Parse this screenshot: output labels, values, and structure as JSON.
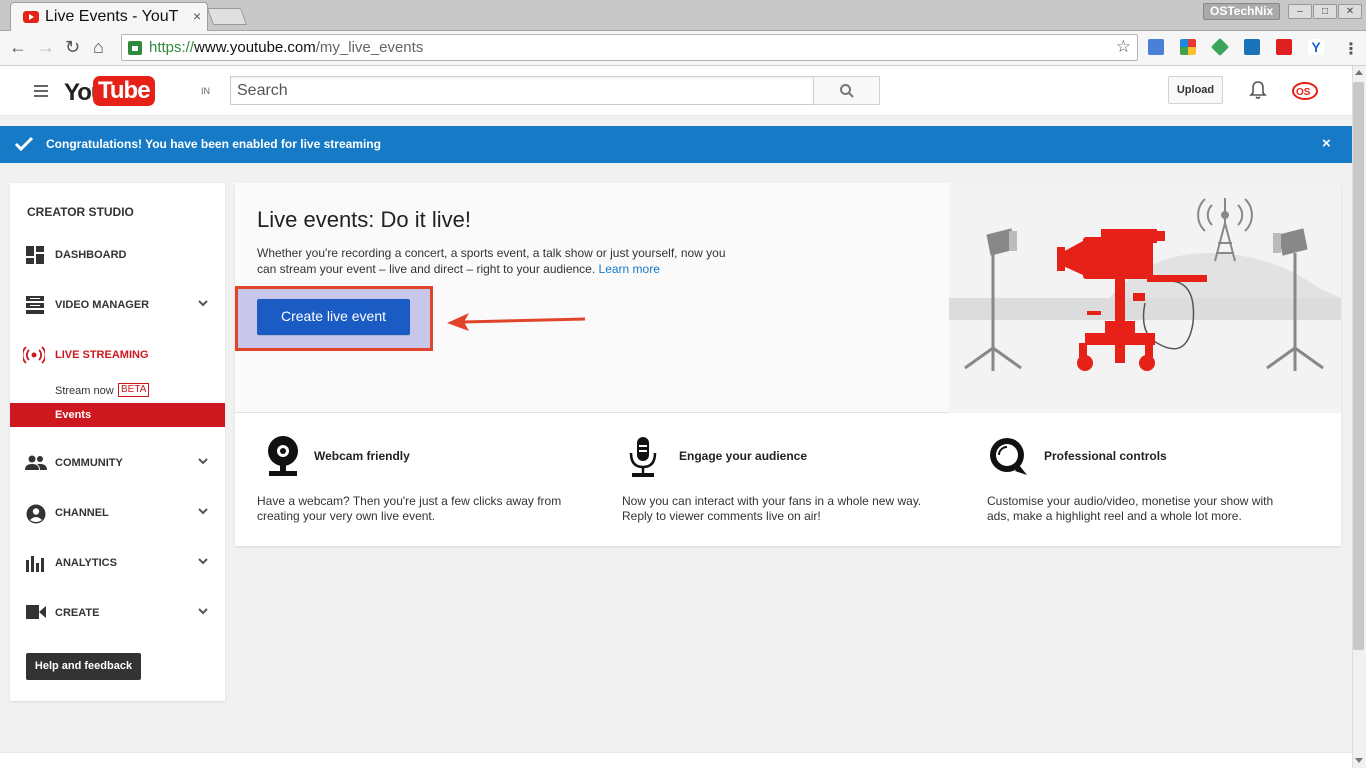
{
  "browser": {
    "tab_title": "Live Events - YouT",
    "tab_close": "×",
    "window_user": "OSTechNix",
    "url_scheme": "https://",
    "url_host": "www.youtube.com",
    "url_path": "/my_live_events"
  },
  "header": {
    "logo_you": "You",
    "logo_tube": "Tube",
    "region": "IN",
    "search_placeholder": "Search",
    "upload_label": "Upload"
  },
  "notice": {
    "text": "Congratulations! You have been enabled for live streaming",
    "close": "×",
    "color": "#167ac6"
  },
  "sidebar": {
    "heading": "CREATOR STUDIO",
    "items": [
      {
        "label": "DASHBOARD"
      },
      {
        "label": "VIDEO MANAGER"
      },
      {
        "label": "LIVE STREAMING"
      },
      {
        "label": "COMMUNITY"
      },
      {
        "label": "CHANNEL"
      },
      {
        "label": "ANALYTICS"
      },
      {
        "label": "CREATE"
      }
    ],
    "sub_items": [
      {
        "label": "Stream now",
        "badge": "BETA"
      },
      {
        "label": "Events",
        "active": true
      }
    ],
    "help_label": "Help and feedback"
  },
  "main": {
    "title": "Live events: Do it live!",
    "description": "Whether you're recording a concert, a sports event, a talk show or just yourself, now you can stream your event – live and direct – right to your audience.",
    "learn_more": "Learn more",
    "create_button": "Create live event",
    "features": [
      {
        "title": "Webcam friendly",
        "desc": "Have a webcam? Then you're just a few clicks away from creating your very own live event.",
        "icon": "webcam-icon"
      },
      {
        "title": "Engage your audience",
        "desc": "Now you can interact with your fans in a whole new way. Reply to viewer comments live on air!",
        "icon": "microphone-icon"
      },
      {
        "title": "Professional controls",
        "desc": "Customise your audio/video, monetise your show with ads, make a highlight reel and a whole lot more.",
        "icon": "search-bubble-icon"
      }
    ]
  },
  "colors": {
    "brand_red": "#e62117",
    "active_red": "#cc181e",
    "primary_blue": "#1b5bc4",
    "annotation": "#e0442b"
  }
}
